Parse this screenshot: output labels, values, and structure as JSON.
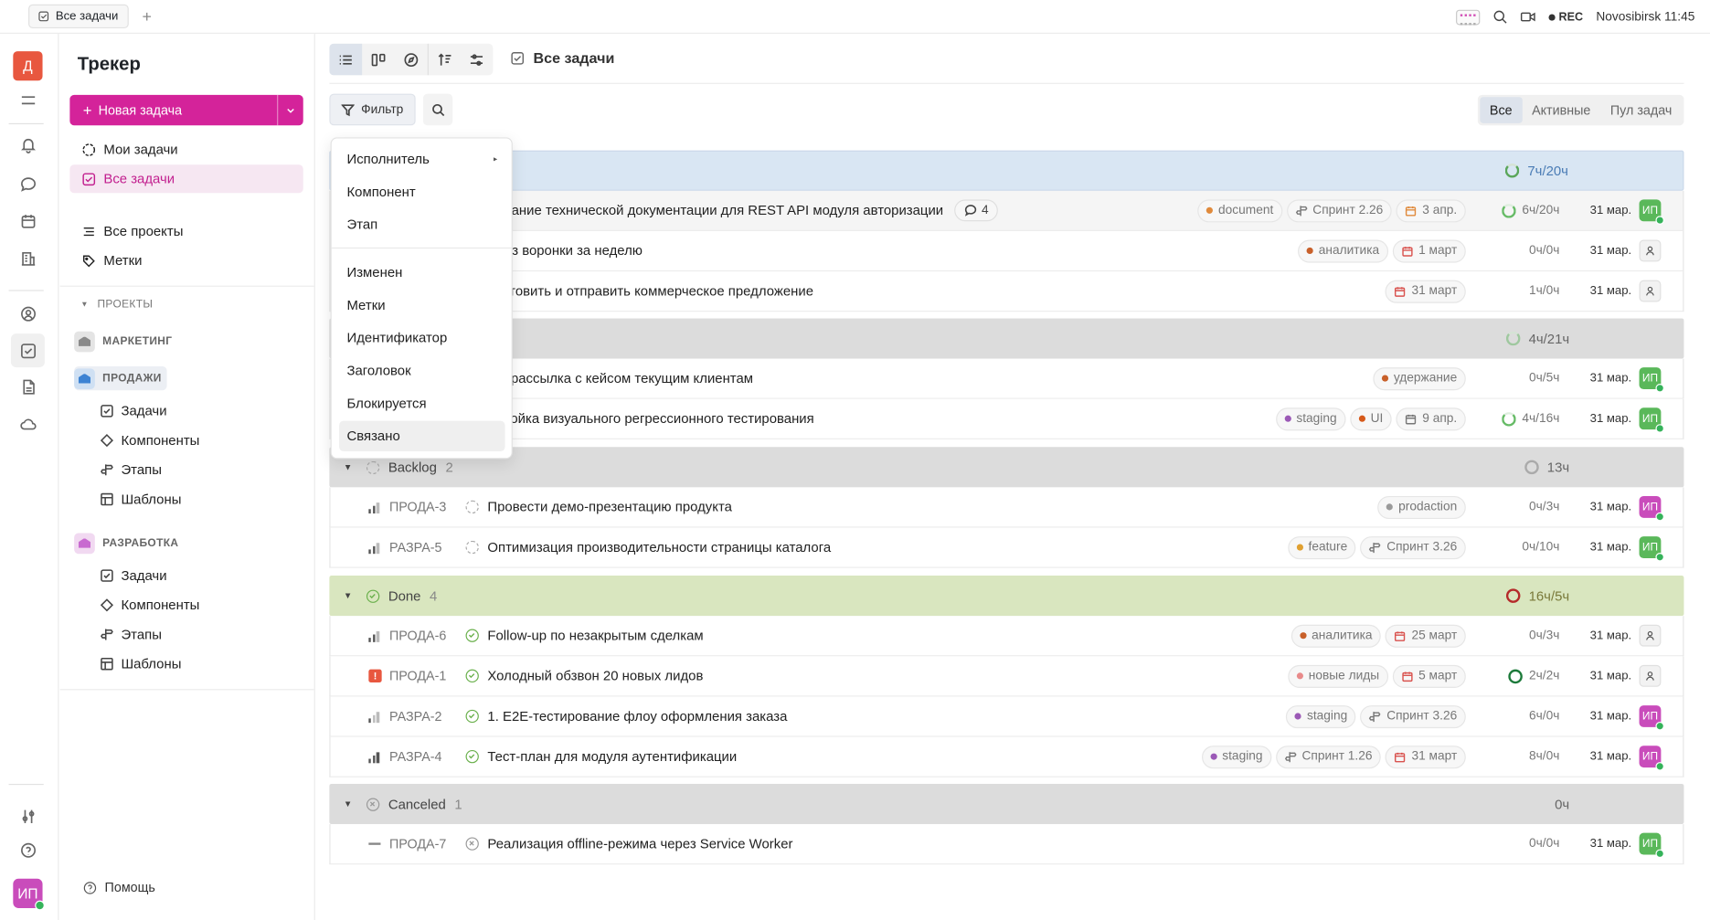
{
  "browser": {
    "tab_label": "Все задачи",
    "tab_plus": "+",
    "rec_label": "REC",
    "location_time": "Novosibirsk 11:45"
  },
  "rail": {
    "logo_letter": "Д",
    "avatar": "ИП"
  },
  "sidebar": {
    "title": "Трекер",
    "new_task_label": "Новая задача",
    "my_tasks": "Мои задачи",
    "all_tasks": "Все задачи",
    "all_projects": "Все проекты",
    "tags": "Метки",
    "projects_section": "ПРОЕКТЫ",
    "projects": [
      {
        "name": "МАРКЕТИНГ",
        "color": "#9a9a9a"
      },
      {
        "name": "ПРОДАЖИ",
        "color": "#4a8fd6"
      },
      {
        "name": "РАЗРАБОТКА",
        "color": "#c86ad0"
      }
    ],
    "sub_items": [
      "Задачи",
      "Компоненты",
      "Этапы",
      "Шаблоны"
    ],
    "help": "Помощь"
  },
  "toolbar": {
    "page_title": "Все задачи",
    "filter_label": "Фильтр",
    "segments": [
      "Все",
      "Активные",
      "Пул задач"
    ],
    "active_segment": "Все"
  },
  "dropdown": {
    "items": [
      "Исполнитель",
      "Компонент",
      "Этап",
      "Изменен",
      "Метки",
      "Идентификатор",
      "Заголовок",
      "Блокируется",
      "Связано"
    ],
    "hovered": "Связано"
  },
  "groups": [
    {
      "name": "",
      "count": "",
      "time": "7ч/20ч",
      "bg": "#d9e6f3"
    },
    {
      "name": "",
      "count": "",
      "time": "4ч/21ч",
      "bg": "#dcdcdc"
    },
    {
      "name": "Backlog",
      "count": "2",
      "time": "13ч",
      "bg": "#dcdcdc"
    },
    {
      "name": "Done",
      "count": "4",
      "time": "16ч/5ч",
      "bg": "#d9e6bf"
    },
    {
      "name": "Canceled",
      "count": "1",
      "time": "0ч",
      "bg": "#dcdcdc"
    }
  ],
  "rows": [
    {
      "id": "",
      "title": "Написание технической документации для REST API модуля авторизации",
      "comments": "4",
      "chips": [
        "document",
        "Спринт 2.26",
        "3 апр."
      ],
      "time": "6ч/20ч",
      "date": "31 мар.",
      "avatar": "ИП"
    },
    {
      "id": "",
      "title": "Анализ воронки за неделю",
      "chips": [
        "аналитика",
        "1 март"
      ],
      "time": "0ч/0ч",
      "date": "31 мар.",
      "avatar": ""
    },
    {
      "id": "",
      "title": "Подготовить и отправить коммерческое предложение",
      "chips": [
        "31 март"
      ],
      "time": "1ч/0ч",
      "date": "31 мар.",
      "avatar": ""
    },
    {
      "id": "",
      "title": "Email-рассылка с кейсом текущим клиентам",
      "chips": [
        "удержание"
      ],
      "time": "0ч/5ч",
      "date": "31 мар.",
      "avatar": "ИП"
    },
    {
      "id": "",
      "title": "Настройка визуального регрессионного тестирования",
      "chips": [
        "staging",
        "UI",
        "9 апр."
      ],
      "time": "4ч/16ч",
      "date": "31 мар.",
      "avatar": "ИП"
    },
    {
      "id": "ПРОДА-3",
      "title": "Провести демо-презентацию продукта",
      "chips": [
        "prodaction"
      ],
      "time": "0ч/3ч",
      "date": "31 мар.",
      "avatar": "ИП"
    },
    {
      "id": "РАЗРА-5",
      "title": "Оптимизация производительности страницы каталога",
      "chips": [
        "feature",
        "Спринт 3.26"
      ],
      "time": "0ч/10ч",
      "date": "31 мар.",
      "avatar": "ИП"
    },
    {
      "id": "ПРОДА-6",
      "title": "Follow-up по незакрытым сделкам",
      "chips": [
        "аналитика",
        "25 март"
      ],
      "time": "0ч/3ч",
      "date": "31 мар.",
      "avatar": ""
    },
    {
      "id": "ПРОДА-1",
      "title": "Холодный обзвон 20 новых лидов",
      "chips": [
        "новые лиды",
        "5 март"
      ],
      "time": "2ч/2ч",
      "date": "31 мар.",
      "avatar": ""
    },
    {
      "id": "РАЗРА-2",
      "title": "1. E2E-тестирование флоу оформления заказа",
      "chips": [
        "staging",
        "Спринт 3.26"
      ],
      "time": "6ч/0ч",
      "date": "31 мар.",
      "avatar": "ИП"
    },
    {
      "id": "РАЗРА-4",
      "title": "Тест-план для модуля аутентификации",
      "chips": [
        "staging",
        "Спринт 1.26",
        "31 март"
      ],
      "time": "8ч/0ч",
      "date": "31 мар.",
      "avatar": "ИП"
    },
    {
      "id": "ПРОДА-7",
      "title": "Реализация offline-режима через Service Worker",
      "chips": [],
      "time": "0ч/0ч",
      "date": "31 мар.",
      "avatar": "ИП"
    }
  ]
}
